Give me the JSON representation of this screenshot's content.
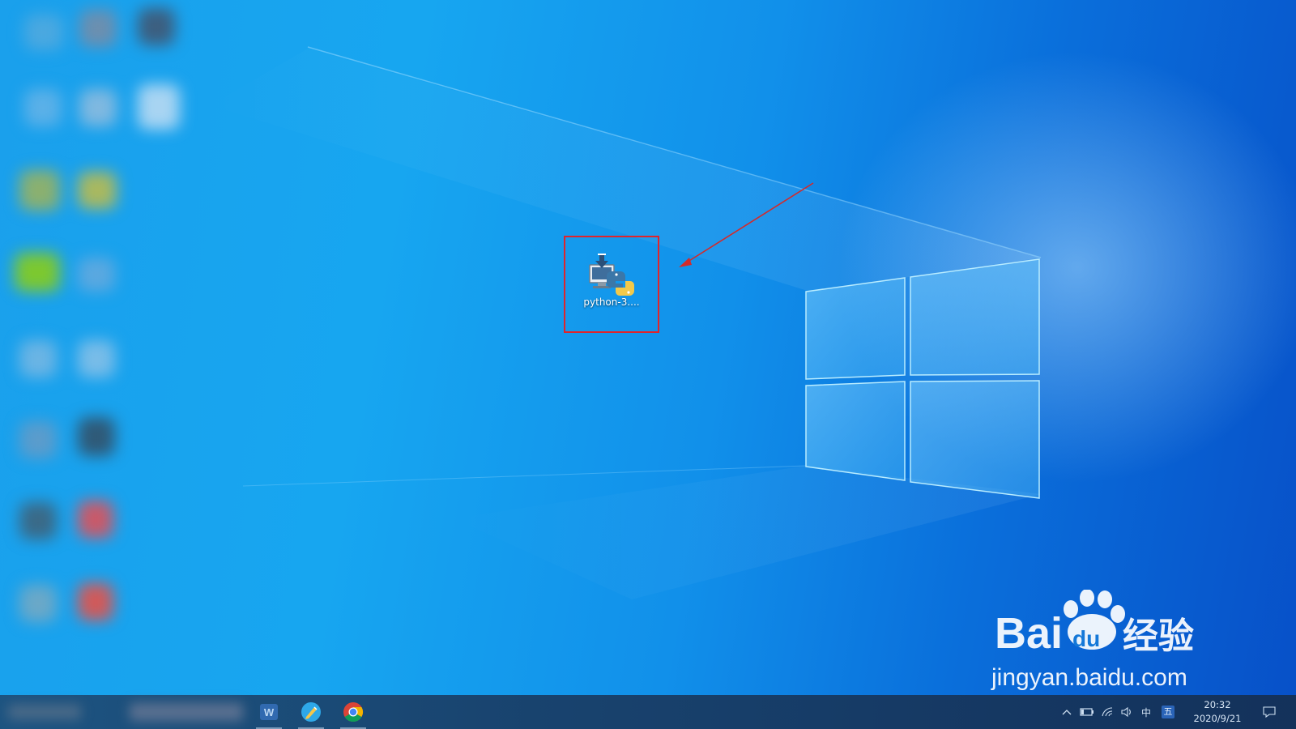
{
  "desktop": {
    "file_icon": {
      "icon": "python-installer-icon",
      "label": "python-3...."
    },
    "highlight_color": "#e0242b"
  },
  "watermark": {
    "brand_left": "Bai",
    "brand_middle": "du",
    "brand_right": "经验",
    "url": "jingyan.baidu.com"
  },
  "taskbar": {
    "apps": [
      {
        "icon": "wps-icon"
      },
      {
        "icon": "edge-pencil-icon"
      },
      {
        "icon": "chrome-icon"
      }
    ],
    "tray": {
      "chevron": "^",
      "ime_lang": "中",
      "ime_mode": "五"
    },
    "clock": {
      "time": "20:32",
      "date": "2020/9/21"
    }
  }
}
